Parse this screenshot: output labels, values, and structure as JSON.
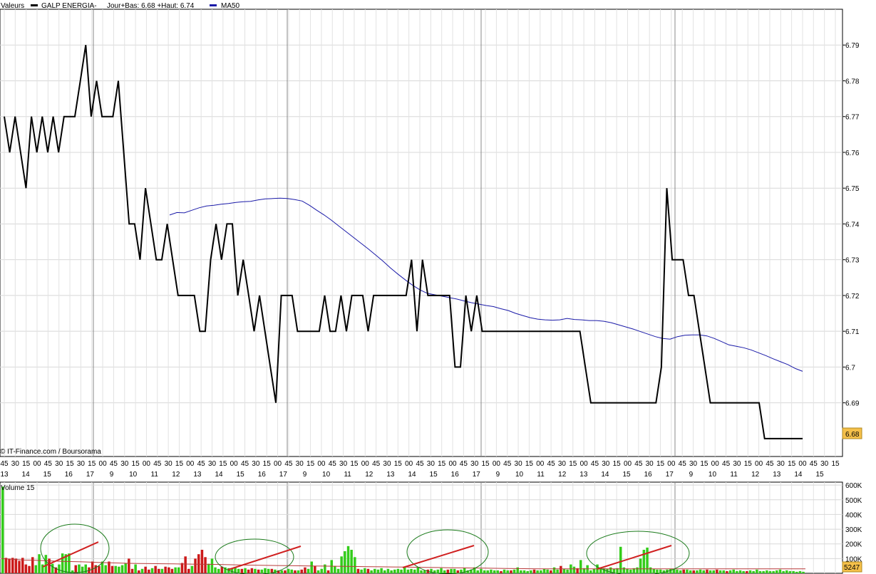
{
  "legend": {
    "label": "Valeurs",
    "instrument": "GALP ENERGIA-",
    "range_text": "Jour+Bas: 6.68 +Haut: 6.74",
    "ma_label": "MA50",
    "price_color": "#000000",
    "ma_color": "#1a1aa8"
  },
  "credit": "© IT-Finance.com / Boursorama",
  "volume_title": "Volume 15",
  "last_price_label": "6.68",
  "last_volume_label": "5247",
  "chart_data": {
    "type": "line",
    "x_tick_minutes": [
      "45",
      "30",
      "15",
      "00",
      "45",
      "30",
      "15",
      "30",
      "15",
      "00",
      "45",
      "30",
      "15",
      "00",
      "45",
      "30",
      "15",
      "00",
      "45",
      "30",
      "15",
      "00",
      "45",
      "30",
      "15",
      "00",
      "45",
      "30",
      "15",
      "00",
      "45",
      "30",
      "15",
      "00",
      "45",
      "30",
      "15",
      "00",
      "45",
      "30",
      "15",
      "00",
      "45",
      "30",
      "15",
      "00",
      "45",
      "30",
      "15",
      "00",
      "45",
      "30",
      "15",
      "00",
      "45",
      "30",
      "15",
      "00",
      "45",
      "30",
      "15",
      "00",
      "45",
      "30",
      "15",
      "00",
      "45",
      "30",
      "15",
      "00",
      "45",
      "30",
      "15",
      "00",
      "45",
      "30",
      "15"
    ],
    "x_tick_hours": [
      "13",
      "14",
      "15",
      "16",
      "17",
      "9",
      "10",
      "11",
      "12",
      "13",
      "14",
      "15",
      "16",
      "17",
      "9",
      "10",
      "11",
      "12",
      "13",
      "14",
      "15",
      "16",
      "17",
      "9",
      "10",
      "11",
      "12",
      "13",
      "14",
      "15",
      "16",
      "17",
      "9",
      "10",
      "11",
      "12",
      "13",
      "14",
      "15"
    ],
    "y_ticks": [
      "6.79",
      "6.78",
      "6.77",
      "6.76",
      "6.75",
      "6.74",
      "6.73",
      "6.72",
      "6.71",
      "6.7",
      "6.69"
    ],
    "ylim": [
      6.675,
      6.8
    ],
    "price": [
      6.77,
      6.76,
      6.77,
      6.76,
      6.75,
      6.77,
      6.76,
      6.77,
      6.76,
      6.77,
      6.76,
      6.77,
      6.77,
      6.77,
      6.78,
      6.79,
      6.77,
      6.78,
      6.77,
      6.77,
      6.77,
      6.78,
      6.76,
      6.74,
      6.74,
      6.73,
      6.75,
      6.74,
      6.73,
      6.73,
      6.74,
      6.73,
      6.72,
      6.72,
      6.72,
      6.72,
      6.71,
      6.71,
      6.73,
      6.74,
      6.73,
      6.74,
      6.74,
      6.72,
      6.73,
      6.72,
      6.71,
      6.72,
      6.71,
      6.7,
      6.69,
      6.72,
      6.72,
      6.72,
      6.71,
      6.71,
      6.71,
      6.71,
      6.71,
      6.72,
      6.71,
      6.71,
      6.72,
      6.71,
      6.72,
      6.72,
      6.72,
      6.71,
      6.72,
      6.72,
      6.72,
      6.72,
      6.72,
      6.72,
      6.72,
      6.73,
      6.71,
      6.73,
      6.72,
      6.72,
      6.72,
      6.72,
      6.72,
      6.7,
      6.7,
      6.72,
      6.71,
      6.72,
      6.71,
      6.71,
      6.71,
      6.71,
      6.71,
      6.71,
      6.71,
      6.71,
      6.71,
      6.71,
      6.71,
      6.71,
      6.71,
      6.71,
      6.71,
      6.71,
      6.71,
      6.71,
      6.71,
      6.7,
      6.69,
      6.69,
      6.69,
      6.69,
      6.69,
      6.69,
      6.69,
      6.69,
      6.69,
      6.69,
      6.69,
      6.69,
      6.69,
      6.7,
      6.75,
      6.73,
      6.73,
      6.73,
      6.72,
      6.72,
      6.71,
      6.7,
      6.69,
      6.69,
      6.69,
      6.69,
      6.69,
      6.69,
      6.69,
      6.69,
      6.69,
      6.69,
      6.68,
      6.68,
      6.68,
      6.68,
      6.68,
      6.68,
      6.68,
      6.68
    ],
    "ma50": [
      6.7425,
      6.7432,
      6.7431,
      6.7438,
      6.7445,
      6.745,
      6.7452,
      6.7455,
      6.7457,
      6.746,
      6.7462,
      6.7463,
      6.7467,
      6.747,
      6.7471,
      6.7472,
      6.7471,
      6.7468,
      6.7464,
      6.7452,
      6.7438,
      6.7425,
      6.741,
      6.7394,
      6.7378,
      6.7362,
      6.7346,
      6.733,
      6.7313,
      6.7296,
      6.7277,
      6.726,
      6.7244,
      6.7229,
      6.7216,
      6.7206,
      6.7202,
      6.7198,
      6.7194,
      6.719,
      6.7185,
      6.718,
      6.7176,
      6.7172,
      6.7169,
      6.7163,
      6.7158,
      6.715,
      6.7144,
      6.7138,
      6.7134,
      6.7132,
      6.7131,
      6.7132,
      6.7136,
      6.7133,
      6.7132,
      6.713,
      6.713,
      6.7128,
      6.7124,
      6.7118,
      6.7112,
      6.7106,
      6.7099,
      6.7092,
      6.7085,
      6.708,
      6.7078,
      6.7085,
      6.7089,
      6.709,
      6.709,
      6.7087,
      6.708,
      6.7071,
      6.7062,
      6.7058,
      6.7054,
      6.7048,
      6.704,
      6.7032,
      6.7023,
      6.7015,
      6.7007,
      6.6996,
      6.6988
    ],
    "volume_ticks": [
      "600K",
      "500K",
      "400K",
      "300K",
      "200K",
      "100K"
    ],
    "volume_ylim": [
      0,
      620000
    ],
    "volume": [
      590000,
      105000,
      100000,
      105000,
      100000,
      85000,
      105000,
      60000,
      50000,
      110000,
      55000,
      130000,
      60000,
      125000,
      100000,
      65000,
      40000,
      60000,
      135000,
      130000,
      135000,
      20000,
      55000,
      60000,
      45000,
      60000,
      40000,
      80000,
      55000,
      50000,
      80000,
      55000,
      80000,
      50000,
      50000,
      45000,
      55000,
      70000,
      100000,
      30000,
      60000,
      20000,
      30000,
      45000,
      25000,
      35000,
      50000,
      30000,
      30000,
      45000,
      40000,
      30000,
      40000,
      40000,
      70000,
      115000,
      30000,
      50000,
      100000,
      130000,
      160000,
      110000,
      65000,
      100000,
      40000,
      30000,
      45000,
      40000,
      35000,
      30000,
      40000,
      30000,
      30000,
      35000,
      25000,
      35000,
      30000,
      25000,
      25000,
      35000,
      30000,
      30000,
      25000,
      20000,
      20000,
      20000,
      30000,
      25000,
      20000,
      20000,
      25000,
      40000,
      30000,
      80000,
      50000,
      20000,
      30000,
      60000,
      20000,
      90000,
      50000,
      30000,
      115000,
      150000,
      185000,
      160000,
      110000,
      30000,
      25000,
      35000,
      30000,
      20000,
      30000,
      25000,
      35000,
      20000,
      30000,
      20000,
      25000,
      30000,
      25000,
      40000,
      25000,
      30000,
      25000,
      40000,
      20000,
      20000,
      25000,
      30000,
      20000,
      25000,
      35000,
      20000,
      25000,
      30000,
      30000,
      20000,
      25000,
      35000,
      20000,
      25000,
      40000,
      20000,
      30000,
      20000,
      20000,
      25000,
      20000,
      20000,
      15000,
      25000,
      20000,
      20000,
      25000,
      40000,
      20000,
      20000,
      15000,
      20000,
      25000,
      20000,
      20000,
      30000,
      25000,
      20000,
      40000,
      25000,
      50000,
      30000,
      25000,
      60000,
      45000,
      35000,
      90000,
      35000,
      55000,
      20000,
      30000,
      60000,
      40000,
      35000,
      30000,
      40000,
      30000,
      35000,
      180000,
      40000,
      30000,
      25000,
      35000,
      40000,
      100000,
      160000,
      175000,
      40000,
      30000,
      25000,
      25000,
      20000,
      25000,
      30000,
      30000,
      25000,
      20000,
      25000,
      25000,
      20000,
      20000,
      20000,
      25000,
      20000,
      25000,
      20000,
      20000,
      25000,
      20000,
      20000,
      15000,
      20000,
      25000,
      15000,
      20000,
      15000,
      15000,
      20000,
      15000,
      25000,
      15000,
      15000,
      20000,
      15000,
      15000,
      20000,
      25000,
      15000,
      20000,
      15000,
      15000,
      10000,
      15000,
      10000
    ],
    "volume_up": [
      1,
      0,
      0,
      0,
      0,
      0,
      0,
      0,
      0,
      0,
      1,
      1,
      1,
      1,
      0,
      1,
      0,
      1,
      1,
      1,
      1,
      1,
      0,
      1,
      1,
      1,
      0,
      0,
      0,
      0,
      1,
      1,
      0,
      0,
      1,
      1,
      1,
      1,
      0,
      0,
      1,
      0,
      1,
      0,
      0,
      1,
      0,
      0,
      1,
      0,
      0,
      0,
      1,
      1,
      0,
      0,
      0,
      1,
      0,
      0,
      0,
      0,
      1,
      1,
      1,
      1,
      0,
      1,
      1,
      1,
      1,
      1,
      0,
      1,
      0,
      0,
      1,
      0,
      1,
      1,
      1,
      0,
      1,
      0,
      1,
      0,
      1,
      1,
      0,
      1,
      0,
      0,
      1,
      1,
      0,
      1,
      1,
      1,
      0,
      1,
      1,
      1,
      1,
      1,
      1,
      1,
      1,
      0,
      1,
      1,
      0,
      1,
      1,
      1,
      1,
      1,
      1,
      1,
      1,
      1,
      1,
      1,
      1,
      1,
      1,
      1,
      1,
      1,
      0,
      1,
      1,
      1,
      1,
      1,
      0,
      1,
      1,
      0,
      1,
      1,
      1,
      1,
      1,
      1,
      1,
      1,
      1,
      1,
      1,
      1,
      0,
      1,
      1,
      0,
      1,
      1,
      1,
      1,
      1,
      1,
      0,
      1,
      1,
      1,
      1,
      0,
      1,
      1,
      0,
      1,
      1,
      1,
      1,
      0,
      1,
      1,
      1,
      1,
      1,
      1,
      1,
      1,
      1,
      1,
      1,
      1,
      1,
      1,
      1,
      1,
      1,
      1,
      1,
      1,
      1,
      1,
      1,
      1,
      1,
      1,
      1,
      1,
      1,
      1,
      1,
      0,
      1,
      1,
      0,
      1,
      1,
      1,
      0,
      1,
      1,
      0,
      1,
      1,
      0,
      1,
      1,
      1,
      1,
      1,
      0,
      1,
      1,
      1,
      1,
      1,
      1,
      1,
      1,
      1,
      1,
      1,
      1,
      1,
      1,
      1,
      1,
      1,
      1,
      1,
      1,
      1,
      1,
      1,
      1,
      1,
      1,
      1,
      1,
      1
    ],
    "volume_ma": [
      100000,
      95000,
      90000,
      88000,
      85000,
      82000,
      80000,
      78000,
      75000,
      72000,
      70000,
      68000,
      67000,
      66000,
      65000,
      64000,
      63000,
      62000,
      61000,
      60000,
      58000,
      56000,
      55000,
      54000,
      53000,
      52000,
      51000,
      50000,
      49000,
      48000,
      47000,
      46000,
      45000,
      44000,
      43000,
      42000,
      41000,
      40000,
      39000,
      38000,
      37000,
      36000,
      35000,
      34000,
      33000,
      32000,
      31000,
      30000,
      30000,
      30000,
      30000,
      30000,
      30000,
      30000,
      30000,
      30000,
      30000,
      30000,
      30000,
      30000,
      30000,
      30000,
      30000,
      30000,
      30000,
      30000,
      30000,
      30000,
      30000,
      30000,
      30000
    ],
    "up_color": "#33cc1a",
    "down_color": "#cc1a1a"
  }
}
